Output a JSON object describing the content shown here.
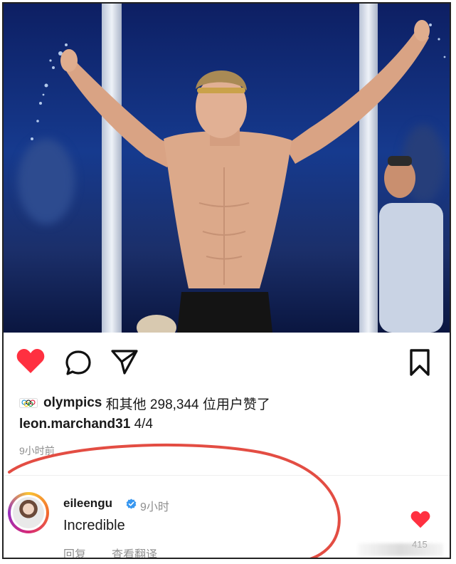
{
  "post": {
    "likes": {
      "account": "olympics",
      "summary": "和其他 298,344 位用户赞了"
    },
    "caption": {
      "username": "leon.marchand31",
      "text": "4/4"
    },
    "time_ago": "9小时前"
  },
  "comment": {
    "username": "eileengu",
    "time": "9小时",
    "text": "Incredible",
    "reply_label": "回复",
    "translate_label": "查看翻译",
    "like_count": "415"
  },
  "icons": {
    "like": "heart-filled-icon",
    "comment": "comment-icon",
    "share": "send-icon",
    "save": "bookmark-icon",
    "verified": "verified-badge-icon",
    "comment_like": "heart-filled-icon",
    "likers_avatar": "olympic-rings-icon"
  },
  "colors": {
    "like_red": "#ff3040",
    "verified_blue": "#3897f0",
    "muted_text": "#8e8e8e",
    "annotation_red": "#e03a2f"
  }
}
